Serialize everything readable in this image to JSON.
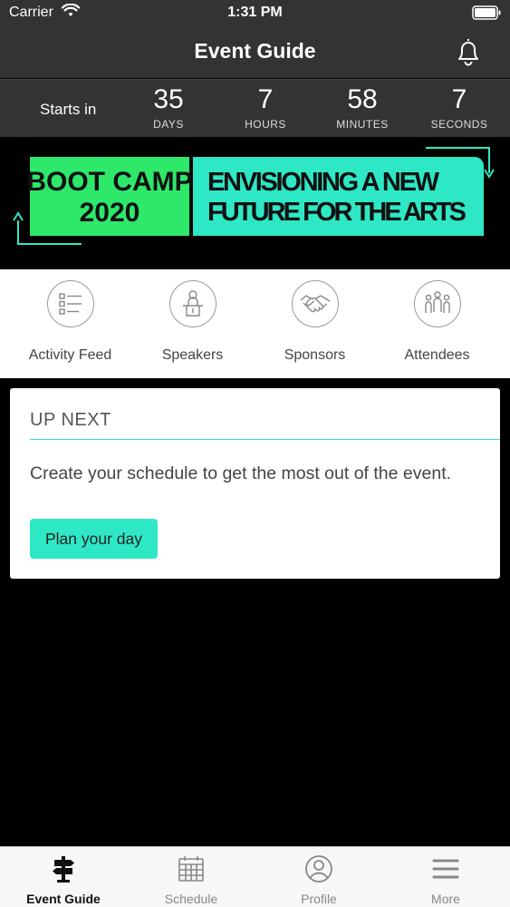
{
  "status_bar": {
    "carrier": "Carrier",
    "time": "1:31 PM"
  },
  "header": {
    "title": "Event Guide",
    "bell_icon": "bell-icon"
  },
  "countdown": {
    "label": "Starts in",
    "units": [
      {
        "value": "35",
        "caption": "DAYS"
      },
      {
        "value": "7",
        "caption": "HOURS"
      },
      {
        "value": "58",
        "caption": "MINUTES"
      },
      {
        "value": "7",
        "caption": "SECONDS"
      }
    ]
  },
  "banner": {
    "left_text_line1": "BOOT CAMP",
    "left_text_line2": "2020",
    "right_text_line1": "ENVISIONING A NEW",
    "right_text_line2": "FUTURE FOR THE ARTS",
    "left_color": "#2ee86a",
    "right_color": "#2ee8c5"
  },
  "quick_links": [
    {
      "label": "Activity Feed",
      "icon": "activity-feed-icon"
    },
    {
      "label": "Speakers",
      "icon": "speaker-icon"
    },
    {
      "label": "Sponsors",
      "icon": "handshake-icon"
    },
    {
      "label": "Attendees",
      "icon": "attendees-icon"
    }
  ],
  "up_next": {
    "heading": "UP NEXT",
    "message": "Create your schedule to get the most out of the event.",
    "button_label": "Plan your day",
    "accent_color": "#2ee8c5"
  },
  "tab_bar": {
    "tabs": [
      {
        "label": "Event Guide",
        "icon": "signpost-icon",
        "active": true
      },
      {
        "label": "Schedule",
        "icon": "calendar-icon",
        "active": false
      },
      {
        "label": "Profile",
        "icon": "profile-icon",
        "active": false
      },
      {
        "label": "More",
        "icon": "hamburger-menu-icon",
        "active": false
      }
    ]
  }
}
